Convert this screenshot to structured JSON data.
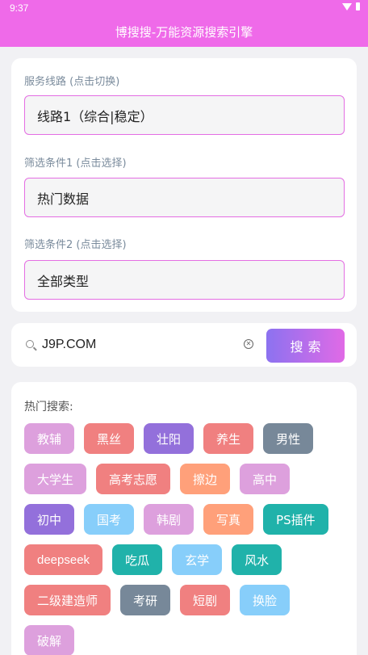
{
  "status_bar": {
    "time": "9:37"
  },
  "header": {
    "title": "博搜搜-万能资源搜索引擎"
  },
  "filters": {
    "route_label": "服务线路 (点击切换)",
    "route_value": "线路1（综合|稳定）",
    "filter1_label": "筛选条件1 (点击选择)",
    "filter1_value": "热门数据",
    "filter2_label": "筛选条件2 (点击选择)",
    "filter2_value": "全部类型"
  },
  "search": {
    "value": "J9P.COM",
    "clear_icon": "clear-circle-icon",
    "button_label": "搜索"
  },
  "hot": {
    "title": "热门搜索:",
    "tags": [
      {
        "label": "教辅",
        "color": "#dda0dd"
      },
      {
        "label": "黑丝",
        "color": "#f08080"
      },
      {
        "label": "壮阳",
        "color": "#9370db"
      },
      {
        "label": "养生",
        "color": "#f08080"
      },
      {
        "label": "男性",
        "color": "#778899"
      },
      {
        "label": "大学生",
        "color": "#dda0dd"
      },
      {
        "label": "高考志愿",
        "color": "#f08080"
      },
      {
        "label": "擦边",
        "color": "#ffa07a"
      },
      {
        "label": "高中",
        "color": "#dda0dd"
      },
      {
        "label": "初中",
        "color": "#9370db"
      },
      {
        "label": "国考",
        "color": "#87cefa"
      },
      {
        "label": "韩剧",
        "color": "#dda0dd"
      },
      {
        "label": "写真",
        "color": "#ffa07a"
      },
      {
        "label": "PS插件",
        "color": "#20b2aa"
      },
      {
        "label": "deepseek",
        "color": "#f08080"
      },
      {
        "label": "吃瓜",
        "color": "#20b2aa"
      },
      {
        "label": "玄学",
        "color": "#87cefa"
      },
      {
        "label": "风水",
        "color": "#20b2aa"
      },
      {
        "label": "二级建造师",
        "color": "#f08080"
      },
      {
        "label": "考研",
        "color": "#778899"
      },
      {
        "label": "短剧",
        "color": "#f08080"
      },
      {
        "label": "换脸",
        "color": "#87cefa"
      },
      {
        "label": "破解",
        "color": "#dda0dd"
      }
    ]
  }
}
